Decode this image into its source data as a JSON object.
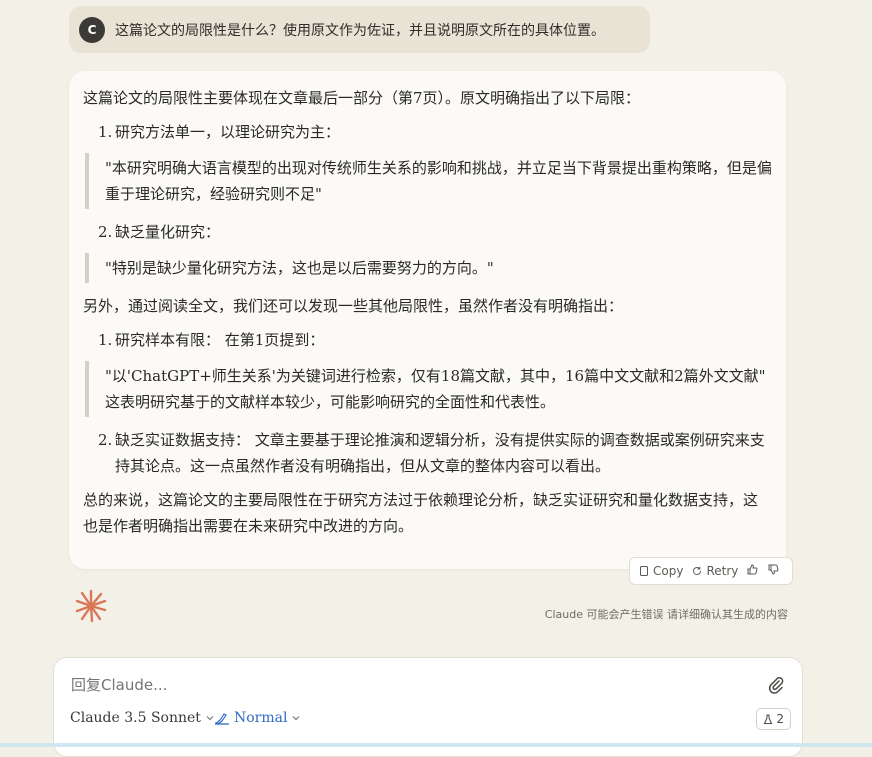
{
  "user_message": {
    "avatar_letter": "C",
    "text": "这篇论文的局限性是什么？使用原文作为佐证，并且说明原文所在的具体位置。"
  },
  "answer": {
    "intro": "这篇论文的局限性主要体现在文章最后一部分（第7页）。原文明确指出了以下局限：",
    "explicit_items": [
      {
        "num": "1.",
        "label": "研究方法单一，以理论研究为主：",
        "quote": "\"本研究明确大语言模型的出现对传统师生关系的影响和挑战，并立足当下背景提出重构策略，但是偏重于理论研究，经验研究则不足\""
      },
      {
        "num": "2.",
        "label": "缺乏量化研究：",
        "quote": "\"特别是缺少量化研究方法，这也是以后需要努力的方向。\""
      }
    ],
    "middle": "另外，通过阅读全文，我们还可以发现一些其他局限性，虽然作者没有明确指出：",
    "other_items": [
      {
        "num": "1.",
        "label": "研究样本有限： 在第1页提到：",
        "quote": "\"以'ChatGPT+师生关系'为关键词进行检索，仅有18篇文献，其中，16篇中文文献和2篇外文文献\"",
        "quote_note": "这表明研究基于的文献样本较少，可能影响研究的全面性和代表性。"
      },
      {
        "num": "2.",
        "label": "缺乏实证数据支持： 文章主要基于理论推演和逻辑分析，没有提供实际的调查数据或案例研究来支持其论点。这一点虽然作者没有明确指出，但从文章的整体内容可以看出。"
      }
    ],
    "conclusion": "总的来说，这篇论文的主要局限性在于研究方法过于依赖理论分析，缺乏实证研究和量化数据支持，这也是作者明确指出需要在未来研究中改进的方向。"
  },
  "actions": {
    "copy": "Copy",
    "retry": "Retry"
  },
  "disclaimer": "Claude 可能会产生错误 请详细确认其生成的内容",
  "composer": {
    "placeholder": "回复Claude...",
    "model": "Claude 3.5 Sonnet",
    "style": "Normal",
    "attachment_count": "2"
  },
  "colors": {
    "accent_logo": "#d97757",
    "style_blue": "#2f6bc5"
  }
}
